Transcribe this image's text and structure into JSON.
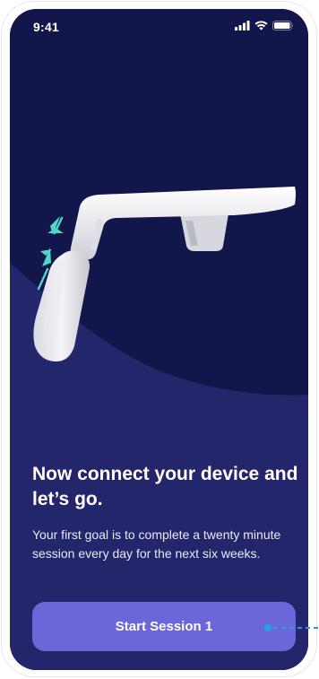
{
  "status_bar": {
    "time": "9:41",
    "icons": [
      "cellular-signal-icon",
      "wifi-icon",
      "battery-icon"
    ]
  },
  "illustration": {
    "name": "bone-conduction-headset",
    "indicator_icon": "compress-arrows-icon",
    "accent_color": "#4fd8c9"
  },
  "onboarding": {
    "headline": "Now connect your device and let’s go.",
    "body": "Your first goal is to complete a twenty minute session every day for the next six weeks."
  },
  "actions": {
    "start_label": "Start Session 1"
  },
  "colors": {
    "background_top": "#13164a",
    "background_bottom": "#23266a",
    "button": "#6b67db",
    "connector": "#2b9be5"
  }
}
